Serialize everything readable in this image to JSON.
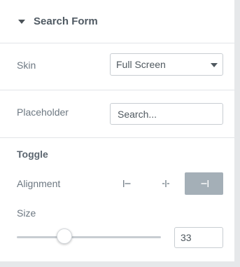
{
  "section": {
    "title": "Search Form"
  },
  "skin": {
    "label": "Skin",
    "value": "Full Screen"
  },
  "placeholder": {
    "label": "Placeholder",
    "value": "Search..."
  },
  "toggle": {
    "heading": "Toggle",
    "alignment": {
      "label": "Alignment",
      "options": [
        {
          "icon": "align-left-icon",
          "active": false
        },
        {
          "icon": "align-center-icon",
          "active": false
        },
        {
          "icon": "align-right-icon",
          "active": true
        }
      ]
    },
    "size": {
      "label": "Size",
      "value": "33",
      "slider_fraction": 0.33
    }
  },
  "colors": {
    "active_align_bg": "#a4afb7",
    "label_text": "#6d7882",
    "border": "#c8cdd2"
  }
}
